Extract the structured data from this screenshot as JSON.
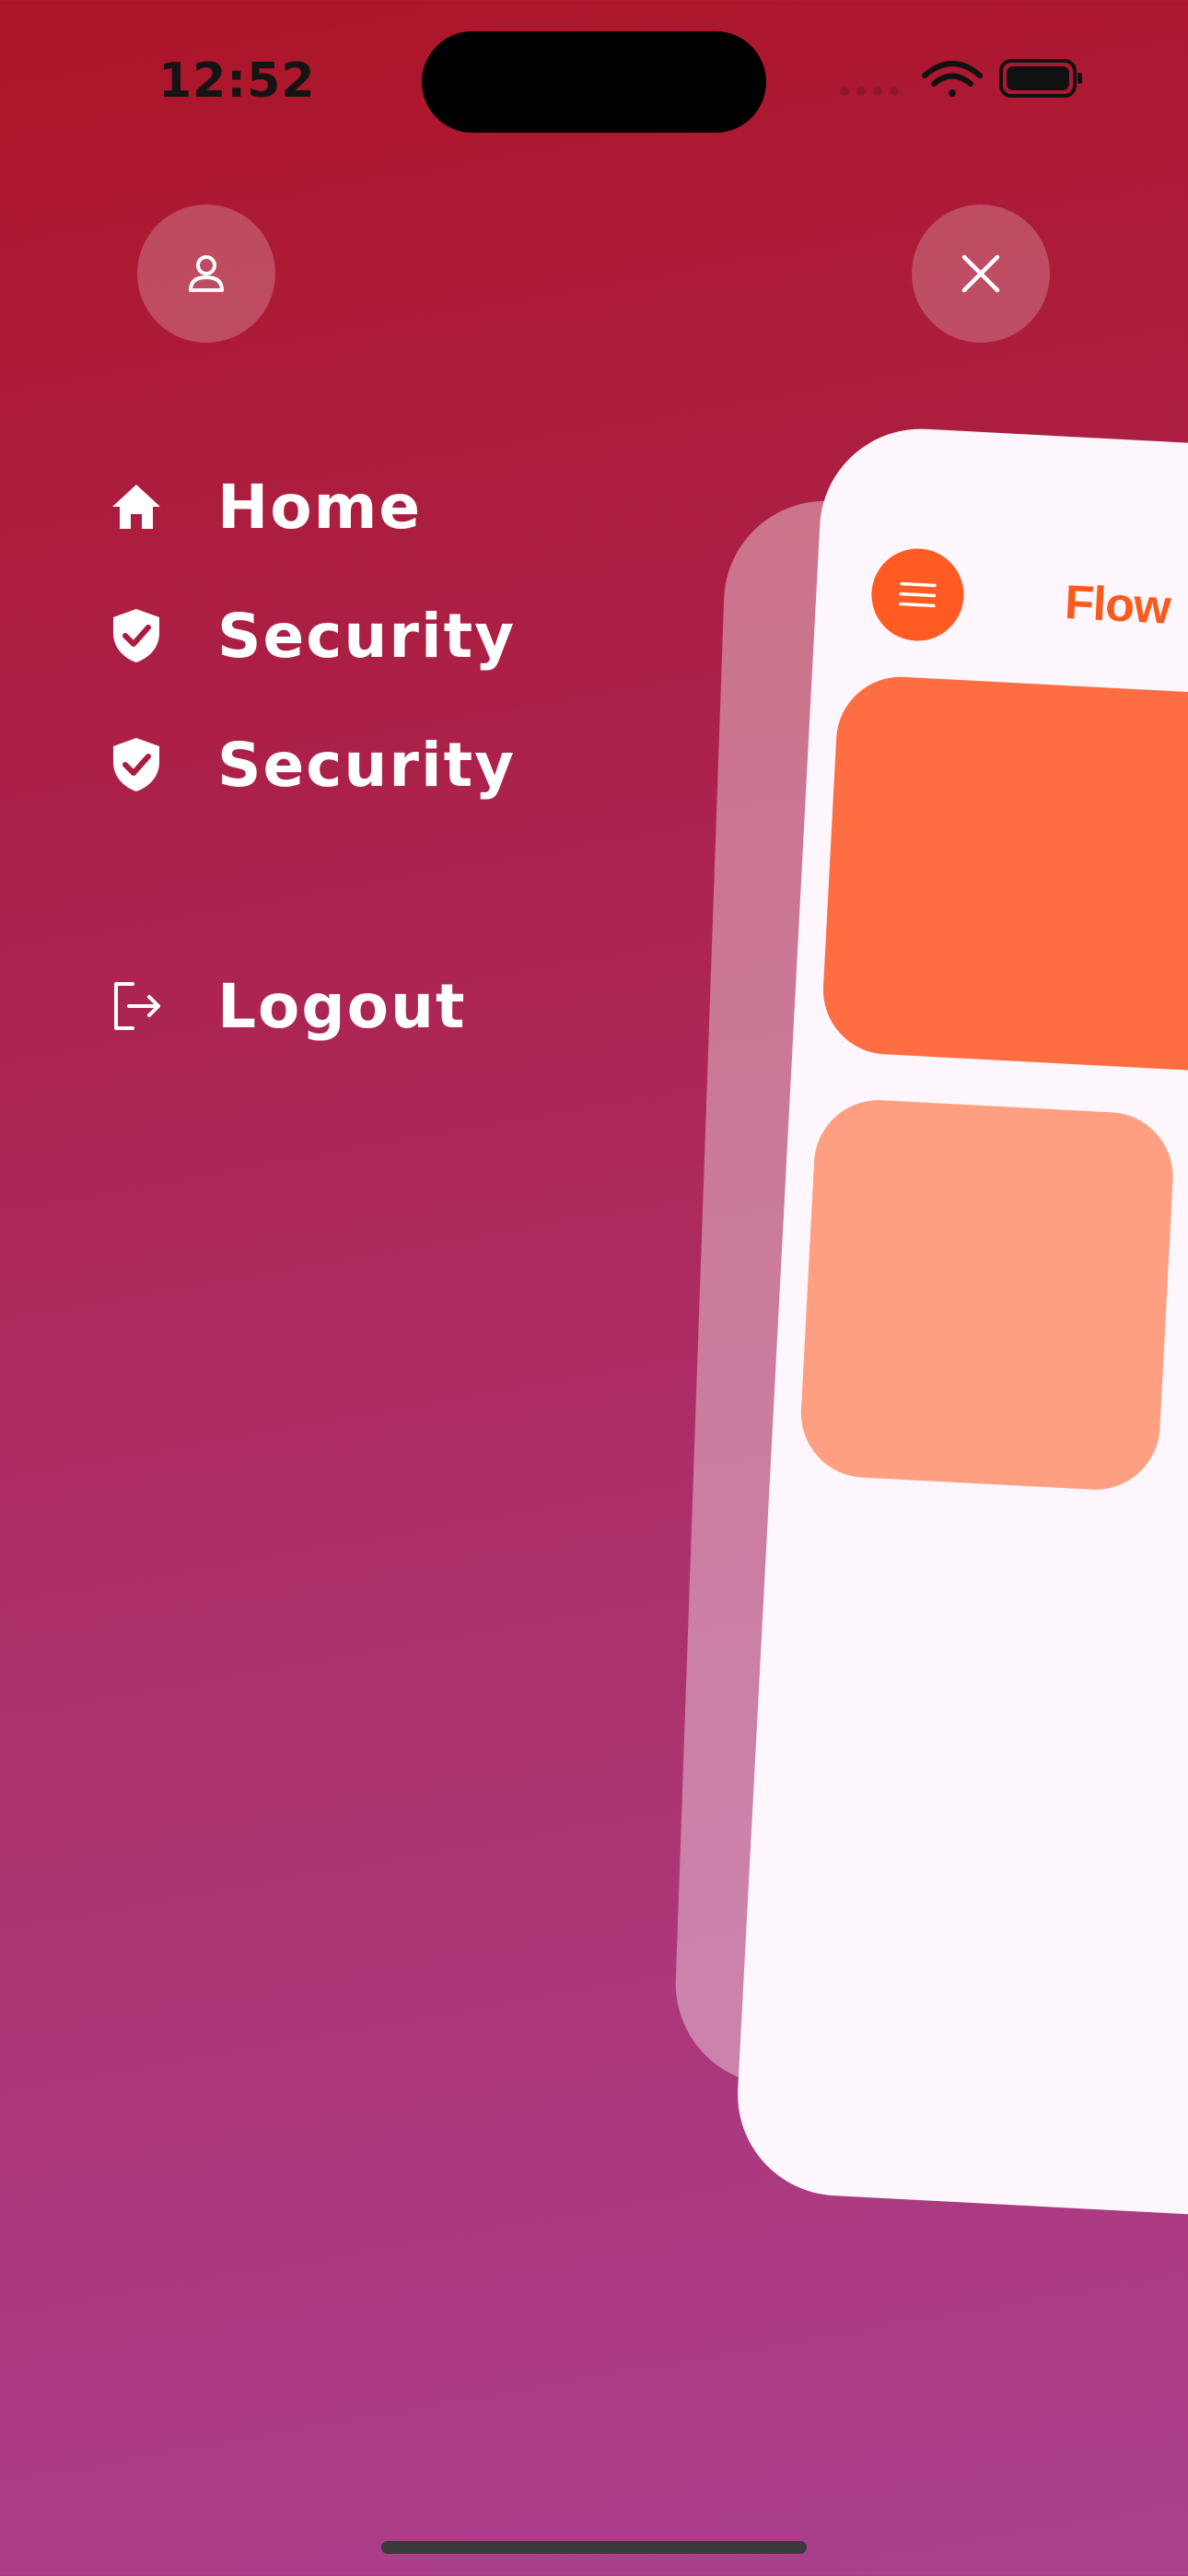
{
  "status_bar": {
    "time": "12:52",
    "icons": [
      "cellular-signal-icon",
      "wifi-icon",
      "battery-icon"
    ]
  },
  "header": {
    "profile_icon": "person-icon",
    "close_icon": "close-icon"
  },
  "menu": {
    "items": [
      {
        "label": "Home",
        "icon": "home-icon"
      },
      {
        "label": "Security",
        "icon": "shield-check-icon"
      },
      {
        "label": "Security",
        "icon": "shield-check-icon"
      }
    ],
    "logout": {
      "label": "Logout",
      "icon": "logout-icon"
    }
  },
  "preview_card": {
    "title": "Flow",
    "menu_icon": "hamburger-menu-icon"
  },
  "colors": {
    "background_top": "#ad1527",
    "background_bottom": "#ab3f8f",
    "accent": "#ff5b23",
    "tile_primary": "#ff6d42",
    "tile_secondary": "#ff9f82",
    "card_background": "#fdf6fc"
  }
}
